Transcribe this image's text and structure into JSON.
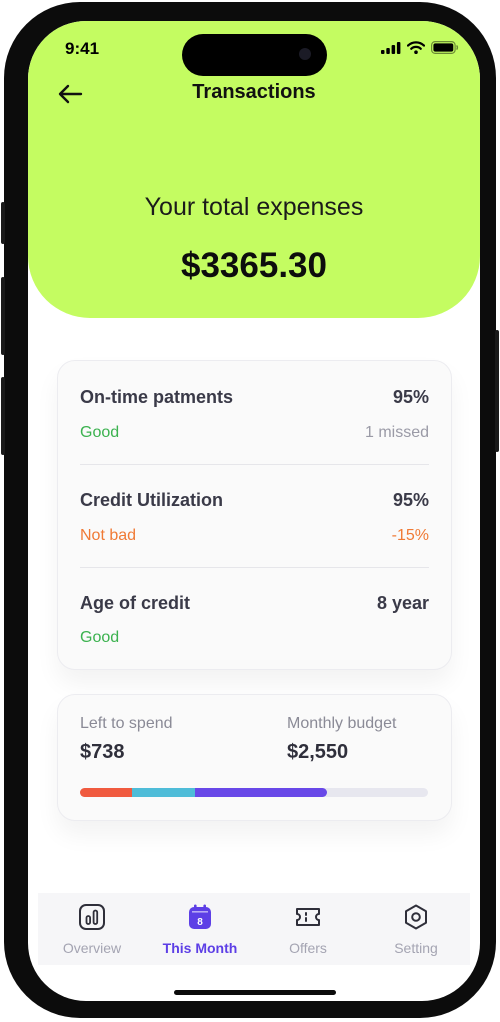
{
  "status_bar": {
    "time": "9:41"
  },
  "header": {
    "title": "Transactions",
    "back_icon": "arrow-left-icon"
  },
  "summary": {
    "label": "Your total expenses",
    "amount": "$3365.30"
  },
  "credit_rows": [
    {
      "name": "On-time patments",
      "value": "95%",
      "status": "Good",
      "detail": "1 missed"
    },
    {
      "name": "Credit Utilization",
      "value": "95%",
      "status": "Not bad",
      "detail": "-15%"
    },
    {
      "name": "Age of credit",
      "value": "8 year",
      "status": "Good",
      "detail": ""
    }
  ],
  "budget": {
    "left_label": "Left to spend",
    "left_value": "$738",
    "monthly_label": "Monthly budget",
    "monthly_value": "$2,550",
    "segments": [
      {
        "fraction": 0.15,
        "color": "#f05a3f"
      },
      {
        "fraction": 0.18,
        "color": "#4ebcd8"
      },
      {
        "fraction": 0.38,
        "color": "#6848e8"
      }
    ]
  },
  "tabs": [
    {
      "label": "Overview",
      "icon": "bar-chart-icon",
      "active": false
    },
    {
      "label": "This Month",
      "icon": "calendar-icon",
      "active": true,
      "badge": "8"
    },
    {
      "label": "Offers",
      "icon": "ticket-icon",
      "active": false
    },
    {
      "label": "Setting",
      "icon": "settings-hexagon-icon",
      "active": false
    }
  ],
  "colors": {
    "accent": "#c4fc61",
    "active_tab": "#5d3fe6",
    "good": "#3bb24f",
    "warning": "#f07a35"
  }
}
